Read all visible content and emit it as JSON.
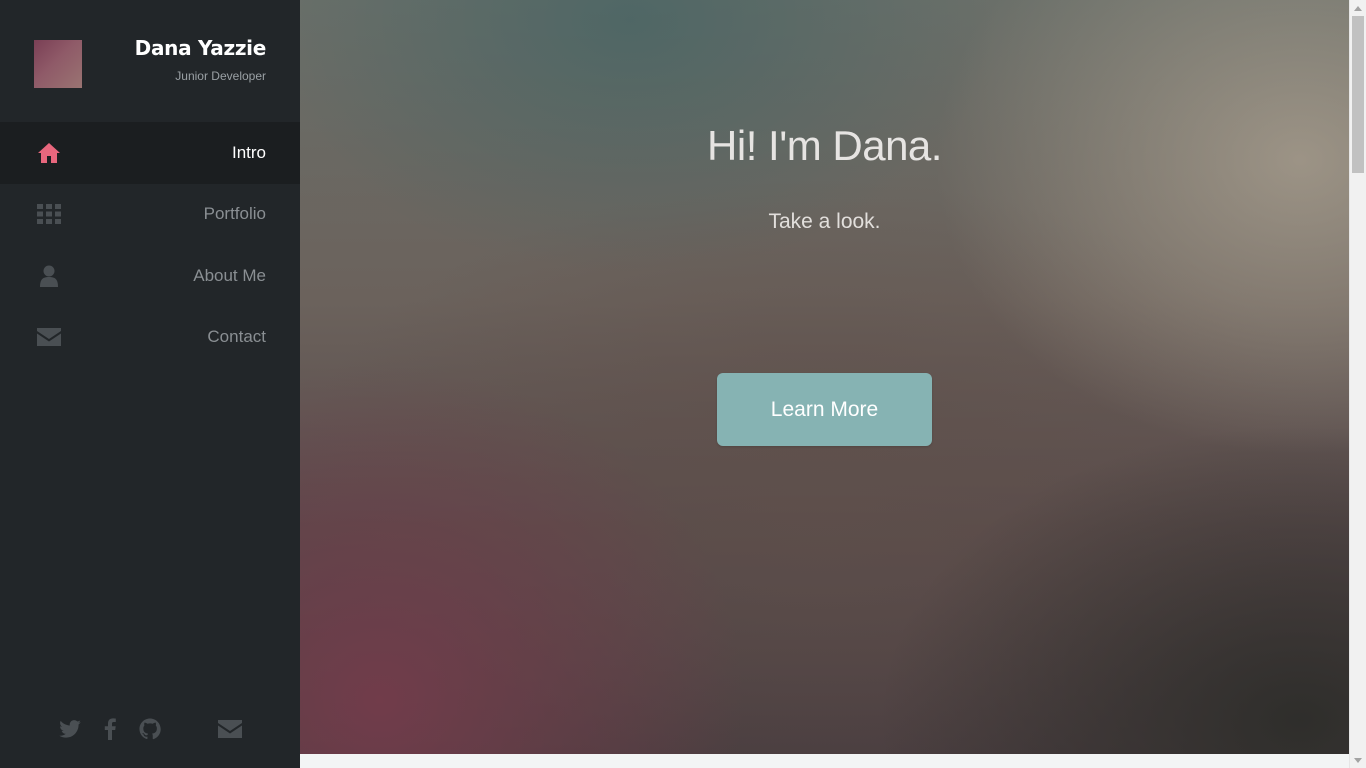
{
  "profile": {
    "name": "Dana Yazzie",
    "role": "Junior Developer"
  },
  "nav": {
    "items": [
      {
        "label": "Intro",
        "icon": "home-icon",
        "active": true
      },
      {
        "label": "Portfolio",
        "icon": "grid-icon",
        "active": false
      },
      {
        "label": "About Me",
        "icon": "user-icon",
        "active": false
      },
      {
        "label": "Contact",
        "icon": "envelope-icon",
        "active": false
      }
    ]
  },
  "social": {
    "icons": [
      "twitter-icon",
      "facebook-icon",
      "github-icon",
      "envelope-icon"
    ]
  },
  "hero": {
    "title": "Hi! I'm Dana.",
    "subtitle": "Take a look.",
    "button_label": "Learn More"
  },
  "colors": {
    "sidebar_bg": "#222629",
    "active_icon": "#e8677d",
    "button_bg": "#86b3b3"
  }
}
